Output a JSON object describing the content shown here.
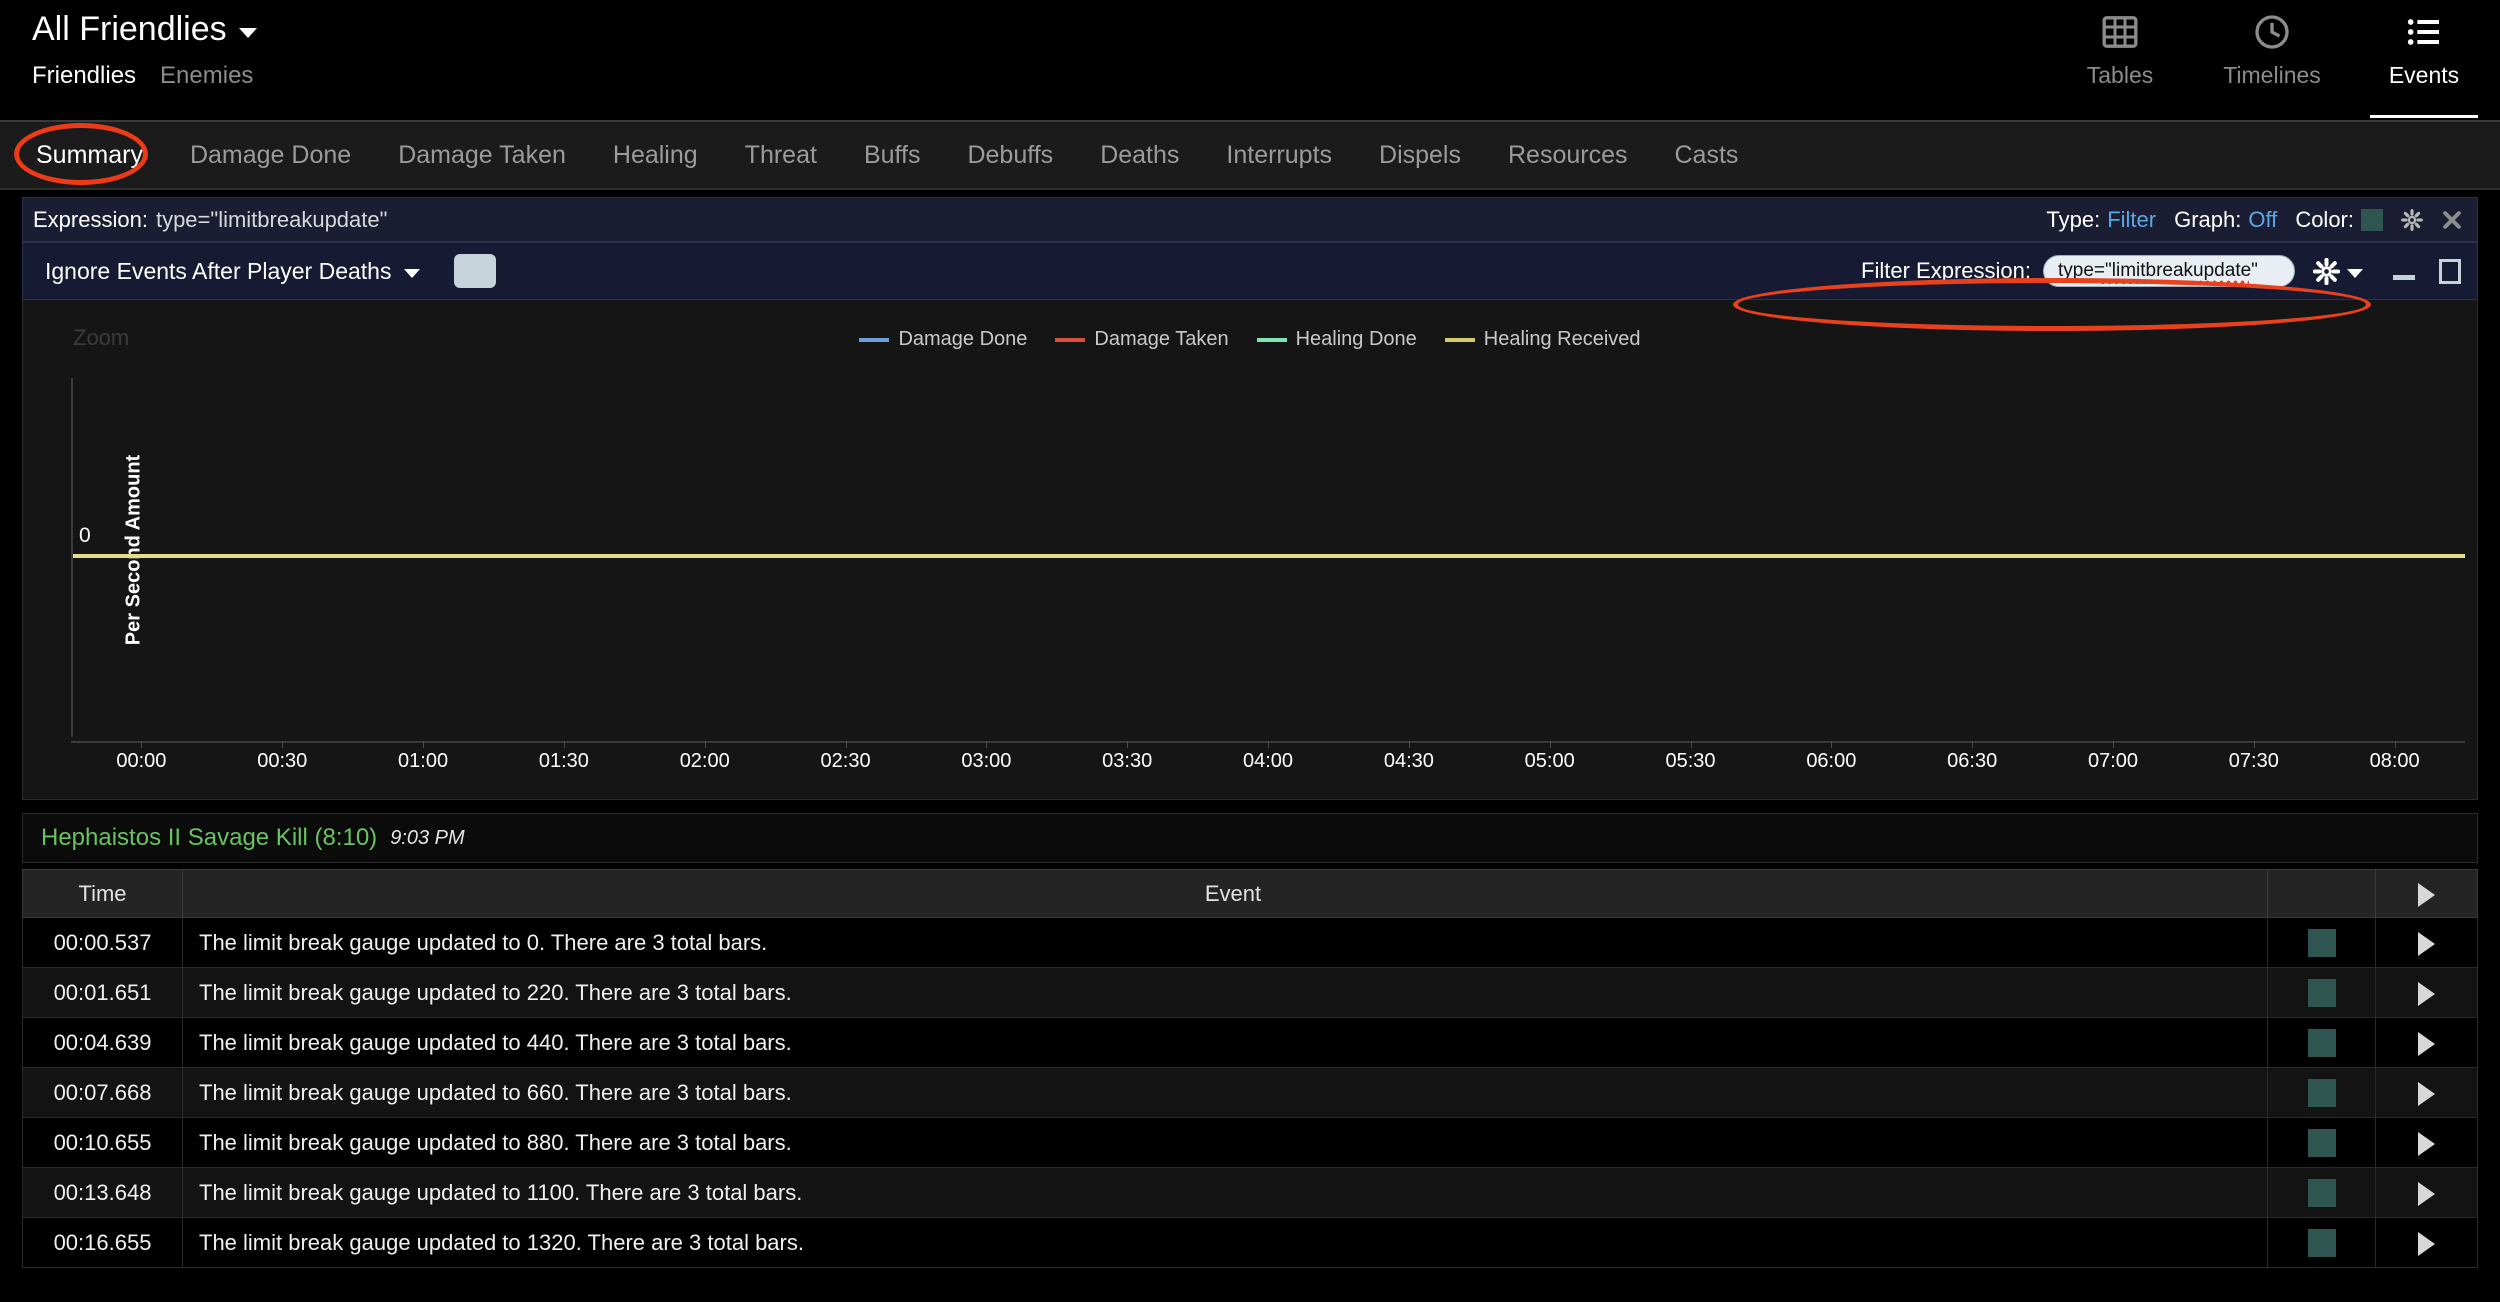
{
  "header": {
    "title": "All Friendlies",
    "side_toggle": [
      {
        "label": "Friendlies",
        "active": true
      },
      {
        "label": "Enemies",
        "active": false
      }
    ],
    "nav": [
      {
        "label": "Tables",
        "icon": "grid-icon",
        "active": false
      },
      {
        "label": "Timelines",
        "icon": "clock-icon",
        "active": false
      },
      {
        "label": "Events",
        "icon": "list-icon",
        "active": true
      }
    ]
  },
  "tabs": [
    {
      "label": "Summary",
      "active": true
    },
    {
      "label": "Damage Done",
      "active": false
    },
    {
      "label": "Damage Taken",
      "active": false
    },
    {
      "label": "Healing",
      "active": false
    },
    {
      "label": "Threat",
      "active": false
    },
    {
      "label": "Buffs",
      "active": false
    },
    {
      "label": "Debuffs",
      "active": false
    },
    {
      "label": "Deaths",
      "active": false
    },
    {
      "label": "Interrupts",
      "active": false
    },
    {
      "label": "Dispels",
      "active": false
    },
    {
      "label": "Resources",
      "active": false
    },
    {
      "label": "Casts",
      "active": false
    }
  ],
  "expression_bar": {
    "label": "Expression:",
    "value": "type=\"limitbreakupdate\"",
    "type_label": "Type:",
    "type_value": "Filter",
    "graph_label": "Graph:",
    "graph_value": "Off",
    "color_label": "Color:",
    "color_value": "#2f5551",
    "gear_icon": "gear-icon",
    "close_icon": "close-icon"
  },
  "toolbar": {
    "ignore_deaths_label": "Ignore Events After Player Deaths",
    "filter_label": "Filter Expression:",
    "filter_value": "type=\"limitbreakupdate\"",
    "filter_placeholder": "Filter Expression",
    "gear_icon": "gear-icon",
    "minimize_icon": "minimize-icon",
    "maximize_icon": "maximize-icon"
  },
  "chart_data": {
    "type": "line",
    "title": "",
    "zoom_label": "Zoom",
    "xlabel": "",
    "ylabel": "Per Second Amount",
    "ytick_labels": [
      "0"
    ],
    "ylim": [
      -1,
      1
    ],
    "grid": false,
    "legend_position": "top-center",
    "x": [
      "00:00",
      "00:30",
      "01:00",
      "01:30",
      "02:00",
      "02:30",
      "03:00",
      "03:30",
      "04:00",
      "04:30",
      "05:00",
      "05:30",
      "06:00",
      "06:30",
      "07:00",
      "07:30",
      "08:00"
    ],
    "series": [
      {
        "name": "Damage Done",
        "color": "#6c9fd8",
        "values": []
      },
      {
        "name": "Damage Taken",
        "color": "#d7503f",
        "values": []
      },
      {
        "name": "Healing Done",
        "color": "#7fe3b0",
        "values": []
      },
      {
        "name": "Healing Received",
        "color": "#d6cb6a",
        "values": [
          0,
          0,
          0,
          0,
          0,
          0,
          0,
          0,
          0,
          0,
          0,
          0,
          0,
          0,
          0,
          0,
          0
        ]
      }
    ]
  },
  "fight": {
    "name": "Hephaistos II Savage Kill (8:10)",
    "time": "9:03 PM"
  },
  "event_table": {
    "columns": [
      "Time",
      "Event",
      "",
      ""
    ],
    "rows": [
      {
        "time": "00:00.537",
        "event": "The limit break gauge updated to 0. There are 3 total bars."
      },
      {
        "time": "00:01.651",
        "event": "The limit break gauge updated to 220. There are 3 total bars."
      },
      {
        "time": "00:04.639",
        "event": "The limit break gauge updated to 440. There are 3 total bars."
      },
      {
        "time": "00:07.668",
        "event": "The limit break gauge updated to 660. There are 3 total bars."
      },
      {
        "time": "00:10.655",
        "event": "The limit break gauge updated to 880. There are 3 total bars."
      },
      {
        "time": "00:13.648",
        "event": "The limit break gauge updated to 1100. There are 3 total bars."
      },
      {
        "time": "00:16.655",
        "event": "The limit break gauge updated to 1320. There are 3 total bars."
      }
    ],
    "swatch_color": "#2f5551",
    "expand_icon": "play-triangle-icon"
  },
  "annotations": {
    "highlight_color": "#ea3d1a",
    "circled": [
      "Summary",
      "Filter Expression"
    ]
  }
}
